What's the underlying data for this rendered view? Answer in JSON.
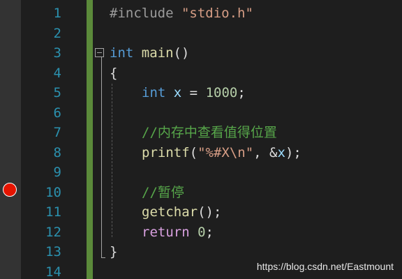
{
  "editor": {
    "line_numbers": [
      "1",
      "2",
      "3",
      "4",
      "5",
      "6",
      "7",
      "8",
      "9",
      "10",
      "11",
      "12",
      "13",
      "14"
    ],
    "breakpoint_line": "10",
    "code": {
      "l1_directive": "#include",
      "l1_header": "\"stdio.h\"",
      "l3_type": "int",
      "l3_name": "main",
      "l3_parens": "()",
      "l4_brace": "{",
      "l5_type": "int",
      "l5_var": "x",
      "l5_assign": " = ",
      "l5_value": "1000",
      "l5_semi": ";",
      "l7_comment": "//内存中查看值得位置",
      "l8_fn": "printf",
      "l8_open": "(",
      "l8_fmt": "\"%#X\\n\"",
      "l8_sep": ", &",
      "l8_arg": "x",
      "l8_close": ");",
      "l10_comment": "//暂停",
      "l11_fn": "getchar",
      "l11_rest": "();",
      "l12_kw": "return",
      "l12_value": "0",
      "l12_semi": ";",
      "l13_brace": "}"
    }
  },
  "watermark": "https://blog.csdn.net/Eastmount",
  "colors": {
    "background": "#1e1e1e",
    "line_number": "#2b91af",
    "keyword": "#569cd6",
    "control_keyword": "#d8a0df",
    "function": "#dcdcaa",
    "variable": "#9cdcfe",
    "number": "#b5cea8",
    "comment": "#57a64a",
    "string": "#d69d85",
    "change_bar": "#5b8a3a",
    "breakpoint": "#e51400"
  }
}
